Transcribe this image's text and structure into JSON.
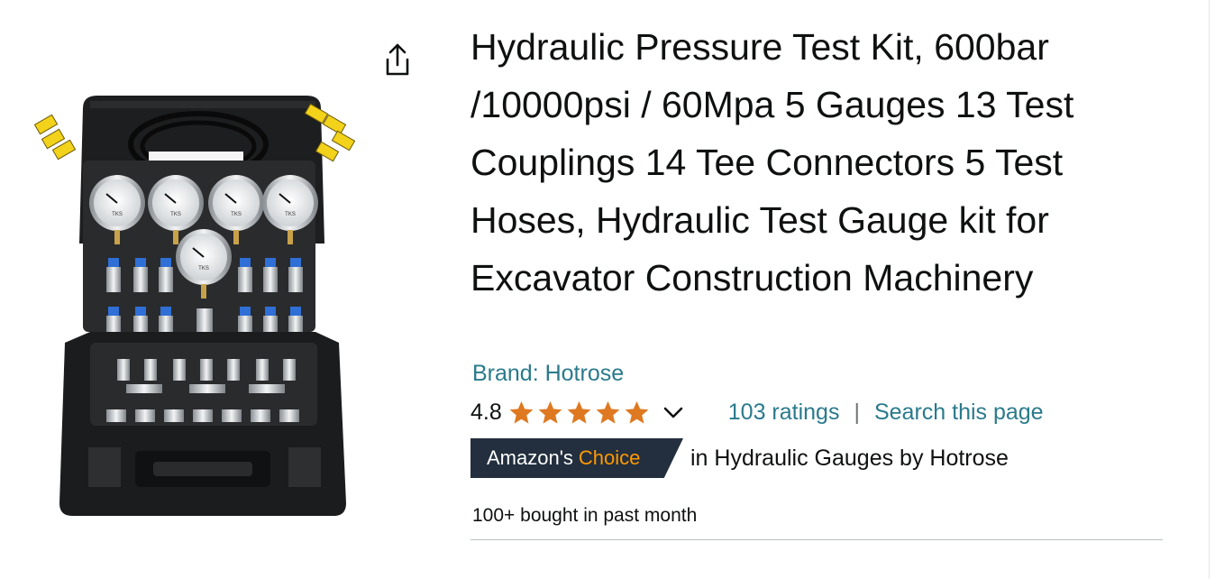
{
  "product": {
    "title": "Hydraulic Pressure Test Kit, 600bar /10000psi / 60Mpa 5 Gauges 13 Test Couplings 14 Tee Connectors 5 Test Hoses, Hydraulic Test Gauge kit for Excavator Construction Machinery",
    "brand_link": "Brand: Hotrose",
    "rating_value": "4.8",
    "star_rating": 4.8,
    "ratings_link": "103 ratings",
    "separator": "|",
    "search_link": "Search this page",
    "badge_prefix": "Amazon's",
    "badge_choice": "Choice",
    "badge_tail": "in Hydraulic Gauges by Hotrose",
    "bought": "100+ bought in past month",
    "gauge_label": "TKS"
  },
  "icons": {
    "share": "share-icon",
    "star": "star-icon",
    "chevron": "chevron-down-icon"
  },
  "colors": {
    "link": "#2a7a8c",
    "star": "#de7921",
    "badge_bg": "#232f3e",
    "badge_accent": "#ff9900",
    "text": "#0f1111"
  }
}
